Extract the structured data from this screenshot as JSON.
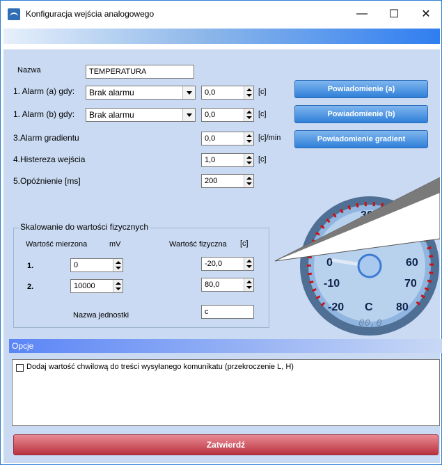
{
  "window": {
    "title": "Konfiguracja wejścia analogowego",
    "minimize_glyph": "—",
    "maximize_glyph": "☐",
    "close_glyph": "✕"
  },
  "form": {
    "name_label": "Nazwa",
    "name_value": "TEMPERATURA",
    "alarm_a_label": "1. Alarm (a) gdy:",
    "alarm_a_select": "Brak alarmu",
    "alarm_a_value": "0,0",
    "alarm_a_unit": "[c]",
    "alarm_b_label": "1. Alarm (b) gdy:",
    "alarm_b_select": "Brak alarmu",
    "alarm_b_value": "0,0",
    "alarm_b_unit": "[c]",
    "gradient_label": "3.Alarm gradientu",
    "gradient_value": "0,0",
    "gradient_unit": "[c]/min",
    "hysteresis_label": "4.Histereza wejścia",
    "hysteresis_value": "1,0",
    "hysteresis_unit": "[c]",
    "delay_label": "5.Opóźnienie [ms]",
    "delay_value": "200"
  },
  "buttons": {
    "notify_a": "Powiadomienie (a)",
    "notify_b": "Powiadomienie (b)",
    "notify_gradient": "Powiadomienie gradient",
    "submit": "Zatwierdź"
  },
  "scaling": {
    "title": "Skalowanie do wartości fizycznych",
    "measured_label": "Wartość mierzona",
    "measured_unit": "mV",
    "physical_label": "Wartość fizyczna",
    "physical_unit": "[c]",
    "row1_index": "1.",
    "row1_measured": "0",
    "row1_physical": "-20,0",
    "row2_index": "2.",
    "row2_measured": "10000",
    "row2_physical": "80,0",
    "unit_name_label": "Nazwa jednostki",
    "unit_name_value": "c"
  },
  "gauge": {
    "ticks": [
      "-20",
      "-10",
      "0",
      "30",
      "60",
      "70",
      "80"
    ],
    "unit": "C",
    "readout": "00,0",
    "needle_value": 0
  },
  "options": {
    "header": "Opcje",
    "checkbox_label": "Dodaj wartość chwilową do treści wysyłanego komunikatu (przekroczenie L, H)",
    "checkbox_checked": false
  },
  "colors": {
    "panel_bg": "#c9daf2",
    "blue_button": "#2f7fd9",
    "submit_button": "#c9424e",
    "gauge_red": "#cc1111"
  }
}
